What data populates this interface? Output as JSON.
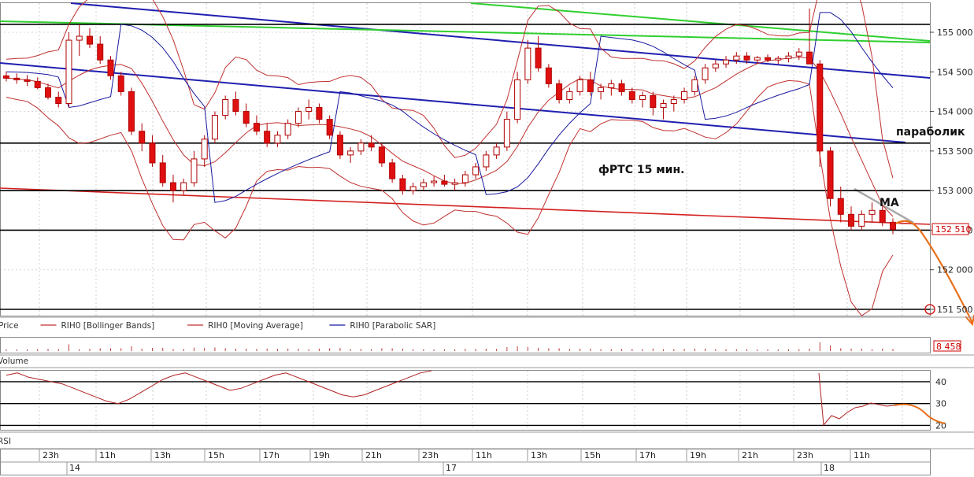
{
  "chart_data": {
    "type": "candlestick",
    "annotations": {
      "title": "фРТС  15 мин.",
      "parabolic": "параболик",
      "ma": "МА"
    },
    "price_axis": {
      "ylim": [
        151450,
        155300
      ],
      "ticks": [
        151500,
        152000,
        152500,
        153000,
        153500,
        154000,
        154500,
        155000
      ],
      "tick_labels": [
        "151 500",
        "152 000",
        "152 500",
        "153 000",
        "153 500",
        "154 000",
        "154 500",
        "155 000"
      ],
      "current_price": 152510,
      "current_label": "152 510"
    },
    "legend": [
      {
        "label": "Price",
        "color": "#c00000"
      },
      {
        "label": "RIH0 [Bollinger Bands]",
        "color": "#c03030"
      },
      {
        "label": "RIH0 [Moving Average]",
        "color": "#c03030"
      },
      {
        "label": "RIH0 [Parabolic SAR]",
        "color": "#1a1aa0"
      }
    ],
    "volume": {
      "label": "Volume",
      "current_label": "8 458"
    },
    "rsi": {
      "label": "RSI",
      "ylim": [
        18,
        45
      ],
      "ticks": [
        20,
        30,
        40
      ],
      "tick_labels": [
        "20",
        "30",
        "40"
      ],
      "values": [
        43,
        44,
        42,
        41,
        40,
        39,
        37,
        35,
        33,
        31,
        30,
        32,
        35,
        38,
        41,
        43,
        44,
        42,
        40,
        38,
        36,
        37,
        39,
        41,
        43,
        44,
        42,
        40,
        38,
        36,
        34,
        33,
        34,
        36,
        38,
        40,
        42,
        44,
        45
      ]
    },
    "time_axis": {
      "hour_labels": [
        "23h",
        "11h",
        "13h",
        "15h",
        "17h",
        "19h",
        "21h",
        "23h",
        "11h",
        "13h",
        "15h",
        "17h",
        "19h",
        "21h",
        "23h",
        "11h"
      ],
      "day_labels": [
        "14",
        "17",
        "18"
      ]
    },
    "candles": [
      [
        154450,
        154500,
        154380,
        154420
      ],
      [
        154420,
        154480,
        154350,
        154400
      ],
      [
        154400,
        154460,
        154320,
        154380
      ],
      [
        154380,
        154430,
        154280,
        154300
      ],
      [
        154300,
        154350,
        154150,
        154180
      ],
      [
        154180,
        154250,
        154050,
        154100
      ],
      [
        154100,
        155000,
        154050,
        154900
      ],
      [
        154900,
        155100,
        154700,
        154950
      ],
      [
        154950,
        155050,
        154800,
        154850
      ],
      [
        154850,
        154950,
        154600,
        154650
      ],
      [
        154650,
        154700,
        154400,
        154450
      ],
      [
        154450,
        154500,
        154200,
        154250
      ],
      [
        154250,
        154300,
        153700,
        153750
      ],
      [
        153750,
        153850,
        153500,
        153600
      ],
      [
        153600,
        153700,
        153300,
        153350
      ],
      [
        153350,
        153450,
        153050,
        153100
      ],
      [
        153100,
        153200,
        152850,
        153000
      ],
      [
        153000,
        153150,
        152950,
        153100
      ],
      [
        153100,
        153500,
        153050,
        153400
      ],
      [
        153400,
        153700,
        153300,
        153650
      ],
      [
        153650,
        154000,
        153600,
        153950
      ],
      [
        153950,
        154200,
        153900,
        154150
      ],
      [
        154150,
        154250,
        153950,
        154000
      ],
      [
        154000,
        154100,
        153800,
        153850
      ],
      [
        153850,
        153950,
        153700,
        153750
      ],
      [
        153750,
        153850,
        153550,
        153600
      ],
      [
        153600,
        153750,
        153550,
        153700
      ],
      [
        153700,
        153900,
        153650,
        153850
      ],
      [
        153850,
        154050,
        153800,
        154000
      ],
      [
        154000,
        154150,
        153900,
        154050
      ],
      [
        154050,
        154100,
        153850,
        153900
      ],
      [
        153900,
        153950,
        153650,
        153700
      ],
      [
        153700,
        153750,
        153400,
        153450
      ],
      [
        153450,
        153550,
        153350,
        153500
      ],
      [
        153500,
        153650,
        153450,
        153600
      ],
      [
        153600,
        153700,
        153500,
        153550
      ],
      [
        153550,
        153600,
        153300,
        153350
      ],
      [
        153350,
        153400,
        153100,
        153150
      ],
      [
        153150,
        153200,
        152950,
        153000
      ],
      [
        153000,
        153100,
        152950,
        153050
      ],
      [
        153050,
        153150,
        153000,
        153100
      ],
      [
        153100,
        153180,
        153050,
        153120
      ],
      [
        153120,
        153200,
        153050,
        153080
      ],
      [
        153080,
        153150,
        153000,
        153100
      ],
      [
        153100,
        153250,
        153050,
        153200
      ],
      [
        153200,
        153350,
        153150,
        153300
      ],
      [
        153300,
        153500,
        153250,
        153450
      ],
      [
        153450,
        153600,
        153400,
        153550
      ],
      [
        153550,
        154000,
        153500,
        153900
      ],
      [
        153900,
        154500,
        153850,
        154400
      ],
      [
        154400,
        154900,
        154350,
        154800
      ],
      [
        154800,
        154950,
        154500,
        154550
      ],
      [
        154550,
        154600,
        154300,
        154350
      ],
      [
        154350,
        154400,
        154100,
        154150
      ],
      [
        154150,
        154300,
        154100,
        154250
      ],
      [
        154250,
        154450,
        154200,
        154400
      ],
      [
        154400,
        154500,
        154200,
        154250
      ],
      [
        154250,
        154350,
        154150,
        154300
      ],
      [
        154300,
        154400,
        154200,
        154350
      ],
      [
        154350,
        154400,
        154200,
        154250
      ],
      [
        154250,
        154300,
        154100,
        154150
      ],
      [
        154150,
        154250,
        154050,
        154200
      ],
      [
        154200,
        154250,
        153950,
        154050
      ],
      [
        154050,
        154150,
        153900,
        154100
      ],
      [
        154100,
        154200,
        154000,
        154150
      ],
      [
        154150,
        154300,
        154100,
        154250
      ],
      [
        154250,
        154450,
        154200,
        154400
      ],
      [
        154400,
        154600,
        154350,
        154550
      ],
      [
        154550,
        154650,
        154500,
        154600
      ],
      [
        154600,
        154700,
        154550,
        154650
      ],
      [
        154650,
        154750,
        154600,
        154700
      ],
      [
        154700,
        154750,
        154600,
        154650
      ],
      [
        154650,
        154700,
        154600,
        154680
      ],
      [
        154680,
        154720,
        154620,
        154650
      ],
      [
        154650,
        154700,
        154600,
        154670
      ],
      [
        154670,
        154750,
        154620,
        154700
      ],
      [
        154700,
        154800,
        154650,
        154750
      ],
      [
        154750,
        155300,
        154700,
        154600
      ],
      [
        154600,
        154650,
        153300,
        153500
      ],
      [
        153500,
        153550,
        152800,
        152900
      ],
      [
        152900,
        153050,
        152600,
        152700
      ],
      [
        152700,
        152800,
        152500,
        152550
      ],
      [
        152550,
        152750,
        152500,
        152700
      ],
      [
        152700,
        152850,
        152600,
        152750
      ],
      [
        152750,
        152800,
        152550,
        152600
      ],
      [
        152600,
        152650,
        152450,
        152510
      ]
    ]
  }
}
